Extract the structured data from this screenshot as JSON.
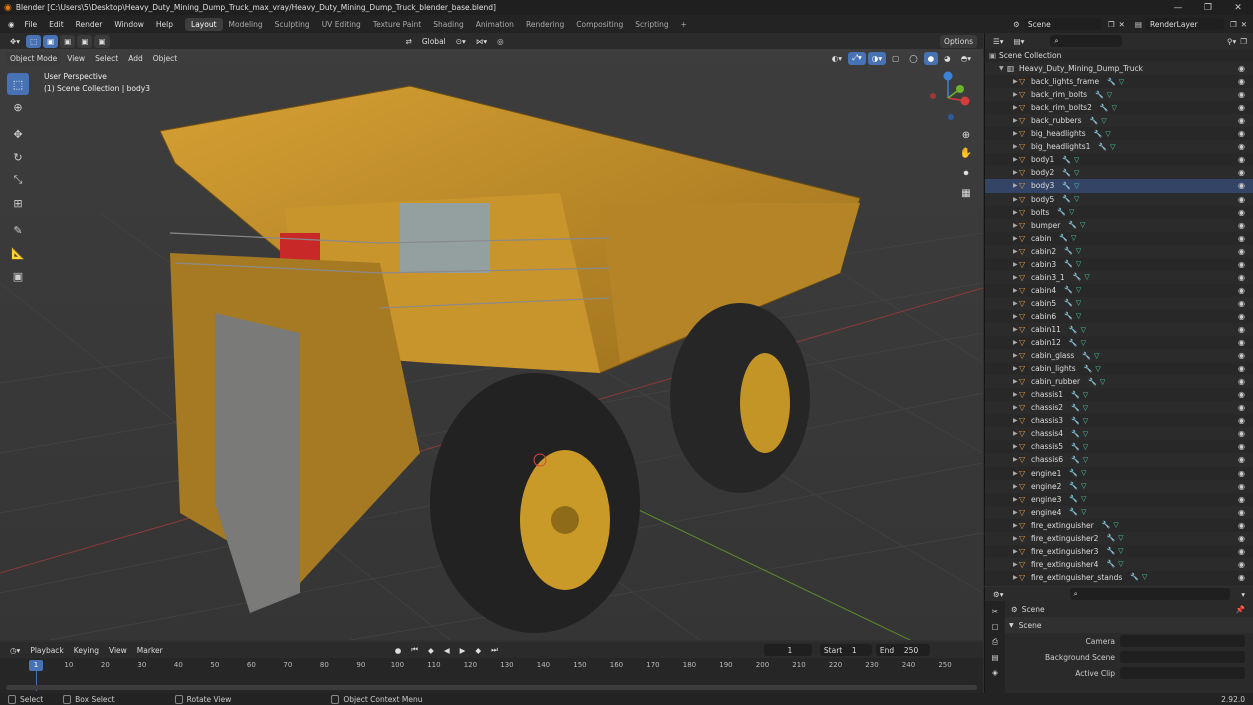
{
  "window": {
    "title": "Blender [C:\\Users\\5\\Desktop\\Heavy_Duty_Mining_Dump_Truck_max_vray/Heavy_Duty_Mining_Dump_Truck_blender_base.blend]",
    "controls": [
      "—",
      "❐",
      "✕"
    ]
  },
  "menu": [
    "File",
    "Edit",
    "Render",
    "Window",
    "Help"
  ],
  "workspaces": [
    "Layout",
    "Modeling",
    "Sculpting",
    "UV Editing",
    "Texture Paint",
    "Shading",
    "Animation",
    "Rendering",
    "Compositing",
    "Scripting"
  ],
  "active_workspace": "Layout",
  "scene_field": "Scene",
  "layer_field": "RenderLayer",
  "viewport": {
    "mode": "Object Mode",
    "menu": [
      "View",
      "Select",
      "Add",
      "Object"
    ],
    "orientation": "Global",
    "options": "Options",
    "info_line1": "User Perspective",
    "info_line2": "(1) Scene Collection | body3"
  },
  "outliner": {
    "root": "Scene Collection",
    "collection": "Heavy_Duty_Mining_Dump_Truck",
    "items": [
      "back_lights_frame",
      "back_rim_bolts",
      "back_rim_bolts2",
      "back_rubbers",
      "big_headlights",
      "big_headlights1",
      "body1",
      "body2",
      "body3",
      "body5",
      "bolts",
      "bumper",
      "cabin",
      "cabin2",
      "cabin3",
      "cabin3_1",
      "cabin4",
      "cabin5",
      "cabin6",
      "cabin11",
      "cabin12",
      "cabin_glass",
      "cabin_lights",
      "cabin_rubber",
      "chassis1",
      "chassis2",
      "chassis3",
      "chassis4",
      "chassis5",
      "chassis6",
      "engine1",
      "engine2",
      "engine3",
      "engine4",
      "fire_extinguisher",
      "fire_extinguisher2",
      "fire_extinguisher3",
      "fire_extinguisher4",
      "fire_extinguisher_stands"
    ],
    "selected": "body3"
  },
  "properties": {
    "header": "Scene",
    "panel": "Scene",
    "fields": [
      {
        "label": "Camera",
        "value": ""
      },
      {
        "label": "Background Scene",
        "value": ""
      },
      {
        "label": "Active Clip",
        "value": ""
      }
    ]
  },
  "timeline": {
    "menu": [
      "Playback",
      "Keying",
      "View",
      "Marker"
    ],
    "current": "1",
    "start_label": "Start",
    "start": "1",
    "end_label": "End",
    "end": "250",
    "ticks": [
      "1",
      "10",
      "20",
      "30",
      "40",
      "50",
      "60",
      "70",
      "80",
      "90",
      "100",
      "110",
      "120",
      "130",
      "140",
      "150",
      "160",
      "170",
      "180",
      "190",
      "200",
      "210",
      "220",
      "230",
      "240",
      "250"
    ]
  },
  "status": {
    "items": [
      "Select",
      "Box Select",
      "Rotate View",
      "Object Context Menu"
    ],
    "version": "2.92.0"
  }
}
